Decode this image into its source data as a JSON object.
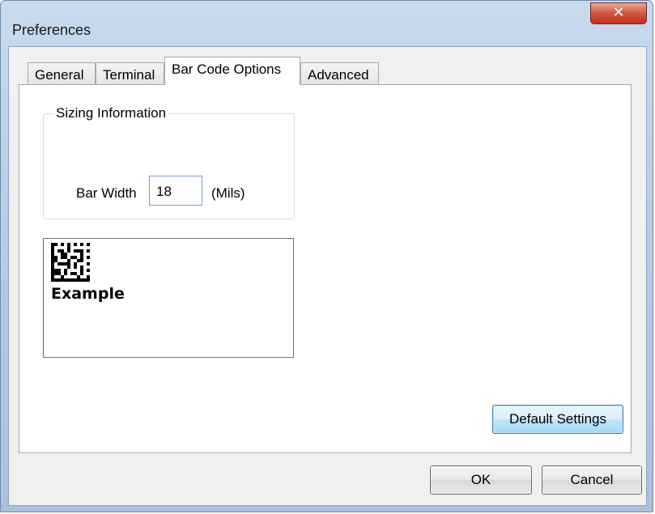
{
  "window": {
    "title": "Preferences",
    "close_glyph": "✕"
  },
  "tabs": [
    {
      "label": "General",
      "active": false
    },
    {
      "label": "Terminal",
      "active": false
    },
    {
      "label": "Bar Code Options",
      "active": true
    },
    {
      "label": "Advanced",
      "active": false
    }
  ],
  "sizing": {
    "group_label": "Sizing Information",
    "bar_width_label": "Bar Width",
    "bar_width_value": "18",
    "unit_label": "(Mils)"
  },
  "preview": {
    "example_text": "Example",
    "barcode_icon": "datamatrix-barcode-icon"
  },
  "buttons": {
    "default_settings": "Default Settings",
    "ok": "OK",
    "cancel": "Cancel"
  },
  "colors": {
    "accent_button_border": "#3c7fb1",
    "close_button": "#c0331e"
  }
}
